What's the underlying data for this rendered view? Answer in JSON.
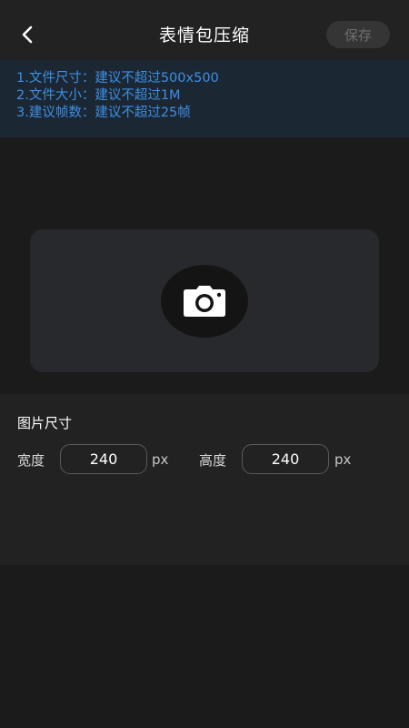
{
  "header": {
    "title": "表情包压缩",
    "save_label": "保存",
    "back_icon": "chevron-left-icon"
  },
  "tips": [
    "1.文件尺寸：建议不超过500x500",
    "2.文件大小：建议不超过1M",
    "3.建议帧数：建议不超过25帧"
  ],
  "upload": {
    "icon": "camera-icon"
  },
  "size_panel": {
    "title": "图片尺寸",
    "width_label": "宽度",
    "width_value": "240",
    "height_label": "高度",
    "height_value": "240",
    "unit": "px"
  },
  "colors": {
    "background": "#1b1b1b",
    "header": "#222222",
    "tips_bg": "#1c2734",
    "tips_text": "#3d8fe3",
    "card": "#27292c"
  }
}
